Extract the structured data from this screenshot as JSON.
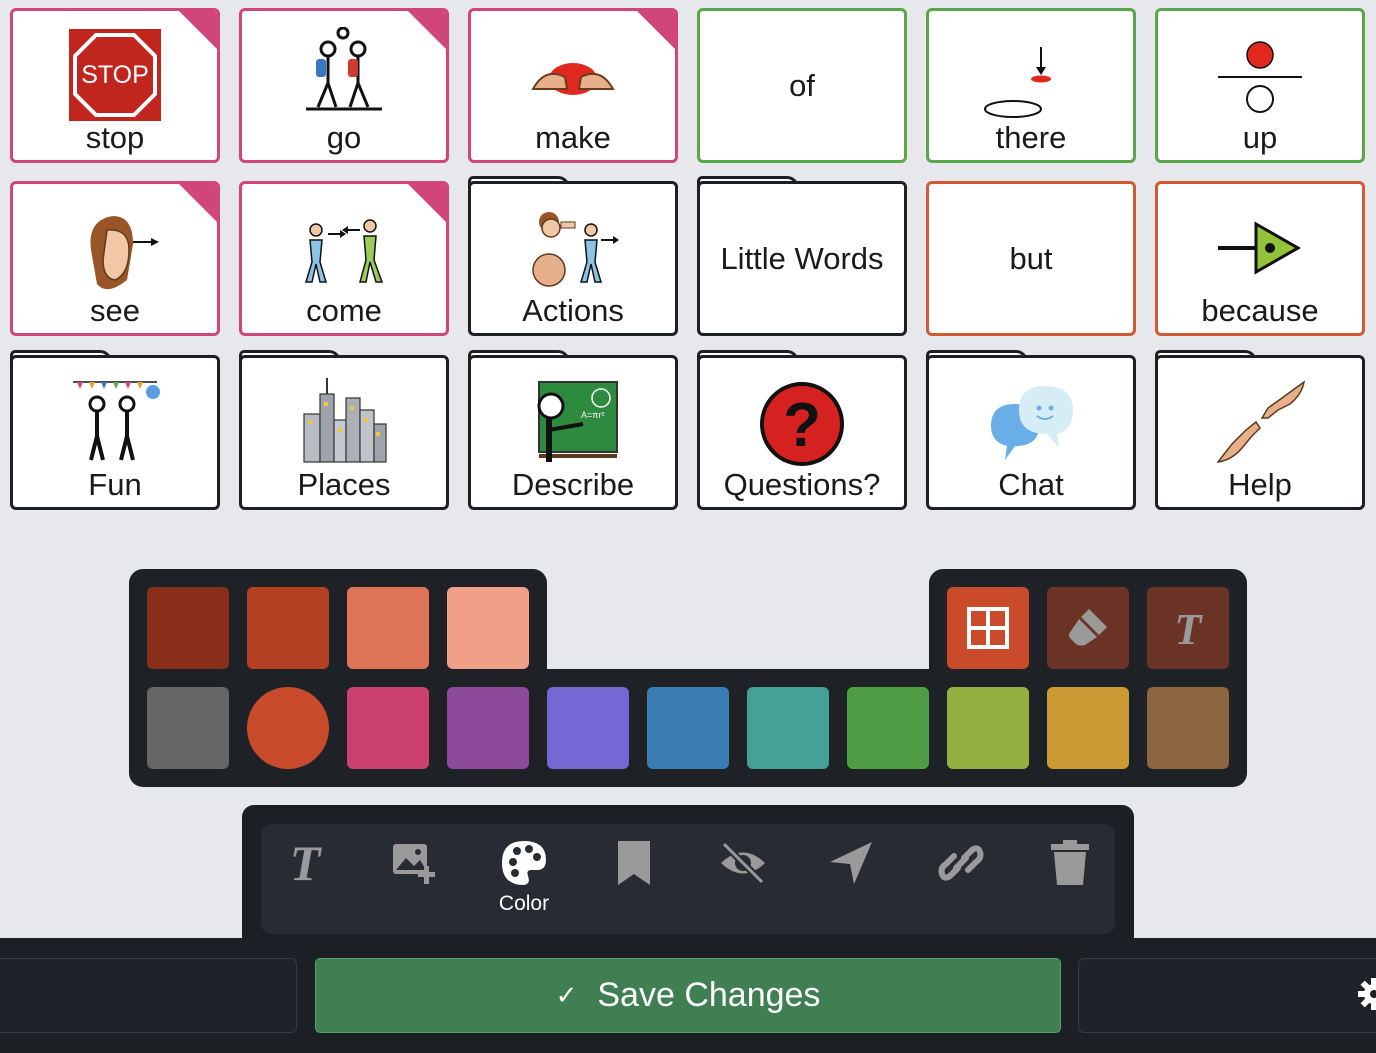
{
  "tiles": [
    {
      "label": "stop",
      "icon": "stop-sign-icon",
      "style": "pink",
      "corner": true
    },
    {
      "label": "go",
      "icon": "go-walking-icon",
      "style": "pink",
      "corner": true
    },
    {
      "label": "make",
      "icon": "make-hands-icon",
      "style": "pink",
      "corner": true
    },
    {
      "label": "of",
      "icon": "",
      "style": "green"
    },
    {
      "label": "there",
      "icon": "there-icon",
      "style": "green"
    },
    {
      "label": "up",
      "icon": "up-icon",
      "style": "green"
    },
    {
      "label": "see",
      "icon": "see-face-icon",
      "style": "pink",
      "corner": true
    },
    {
      "label": "come",
      "icon": "come-people-icon",
      "style": "pink",
      "corner": true
    },
    {
      "label": "Actions",
      "icon": "actions-people-icon",
      "style": "folder"
    },
    {
      "label": "Little Words",
      "icon": "",
      "style": "folder"
    },
    {
      "label": "but",
      "icon": "",
      "style": "orange"
    },
    {
      "label": "because",
      "icon": "because-arrow-icon",
      "style": "orange"
    },
    {
      "label": "Fun",
      "icon": "fun-party-icon",
      "style": "folder"
    },
    {
      "label": "Places",
      "icon": "places-city-icon",
      "style": "folder"
    },
    {
      "label": "Describe",
      "icon": "describe-teacher-icon",
      "style": "folder"
    },
    {
      "label": "Questions?",
      "icon": "question-mark-icon",
      "style": "folder"
    },
    {
      "label": "Chat",
      "icon": "chat-bubbles-icon",
      "style": "folder"
    },
    {
      "label": "Help",
      "icon": "help-hands-icon",
      "style": "folder"
    }
  ],
  "palette": {
    "top_colors": [
      "#8a2f1a",
      "#b23f22",
      "#e07456",
      "#f0a086"
    ],
    "bottom_colors": [
      "#666666",
      "#c94b2b",
      "#cc4070",
      "#8d4a9a",
      "#7468d4",
      "#3a7db2",
      "#45a197",
      "#4e9c43",
      "#94ae42",
      "#cc9a35",
      "#8c653f"
    ],
    "selected_index": 1,
    "tools": [
      {
        "icon": "grid-layout-icon",
        "bg": "#c94b2b"
      },
      {
        "icon": "paint-bucket-icon",
        "bg": "#6b3226"
      },
      {
        "icon": "text-style-icon",
        "bg": "#6b3226"
      }
    ]
  },
  "toolbar": {
    "tools": [
      {
        "icon": "text-icon",
        "label": ""
      },
      {
        "icon": "add-image-icon",
        "label": ""
      },
      {
        "icon": "palette-icon",
        "label": "Color"
      },
      {
        "icon": "bookmark-icon",
        "label": ""
      },
      {
        "icon": "eye-slash-icon",
        "label": ""
      },
      {
        "icon": "location-arrow-icon",
        "label": ""
      },
      {
        "icon": "link-icon",
        "label": ""
      },
      {
        "icon": "trash-icon",
        "label": ""
      }
    ]
  },
  "footer": {
    "save_label": "Save Changes",
    "check": "✓"
  }
}
